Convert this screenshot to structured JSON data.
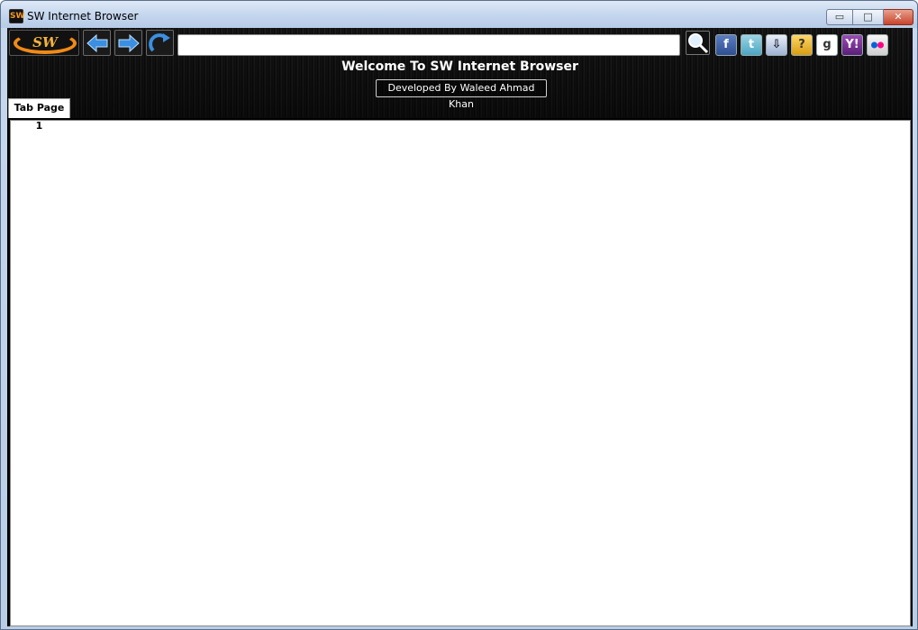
{
  "window": {
    "title": "SW Internet Browser",
    "app_icon_text": "SW",
    "controls": {
      "minimize": "▭",
      "maximize": "□",
      "close": "✕"
    }
  },
  "toolbar": {
    "logo_text": "SW",
    "logo_icon": "sw-logo-icon",
    "back_icon": "arrow-left-icon",
    "forward_icon": "arrow-right-icon",
    "refresh_icon": "refresh-icon",
    "url_value": "",
    "url_placeholder": "",
    "search_icon": "magnifier-icon",
    "social": [
      {
        "name": "facebook",
        "glyph": "f"
      },
      {
        "name": "twitter",
        "glyph": "t"
      },
      {
        "name": "download",
        "glyph": "⇩"
      },
      {
        "name": "help",
        "glyph": "?"
      },
      {
        "name": "google",
        "glyph": "g"
      },
      {
        "name": "yahoo",
        "glyph": "Y!"
      },
      {
        "name": "flickr",
        "glyph": "●●"
      }
    ]
  },
  "banner": {
    "welcome": "Welcome To SW Internet Browser",
    "developer": "Developed By Waleed Ahmad Khan"
  },
  "tabs": [
    {
      "label": "Tab Page 1",
      "active": true
    }
  ],
  "colors": {
    "accent_orange": "#f08a16",
    "arrow_blue": "#3b8fe0",
    "titlebar": "#c5d7ee",
    "toolbar_bg": "#111111"
  }
}
